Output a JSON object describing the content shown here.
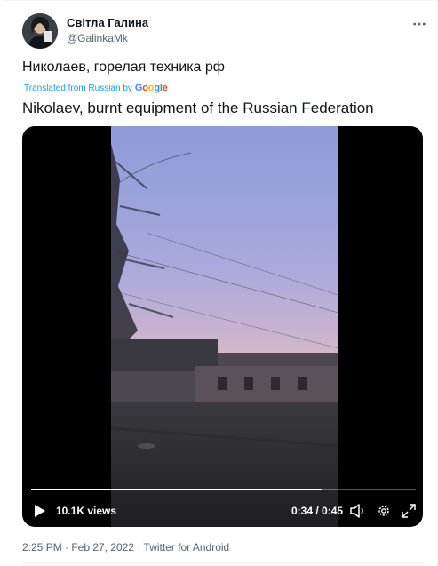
{
  "author": {
    "name": "Світла Галина",
    "handle": "@GalinkaMk"
  },
  "tweet": {
    "text": "Николаев, горелая техника рф",
    "translated_label": "Translated from Russian by",
    "translated_provider": "Google",
    "translation": "Nikolaev, burnt equipment of the Russian Federation"
  },
  "video": {
    "views": "10.1K views",
    "time": "0:34 / 0:45",
    "progress": 0.756
  },
  "meta": {
    "timestamp": "2:25 PM · Feb 27, 2022 · Twitter for Android"
  },
  "icons": {
    "more": "more-horizontal-icon",
    "play": "play-icon",
    "volume": "volume-icon",
    "settings": "gear-icon",
    "fullscreen": "fullscreen-icon"
  },
  "colors": {
    "link": "#1d9bf0",
    "secondary_text": "#536471",
    "google_blue": "#4285f4",
    "google_red": "#ea4335",
    "google_yellow": "#fbbc05",
    "google_green": "#34a853"
  }
}
